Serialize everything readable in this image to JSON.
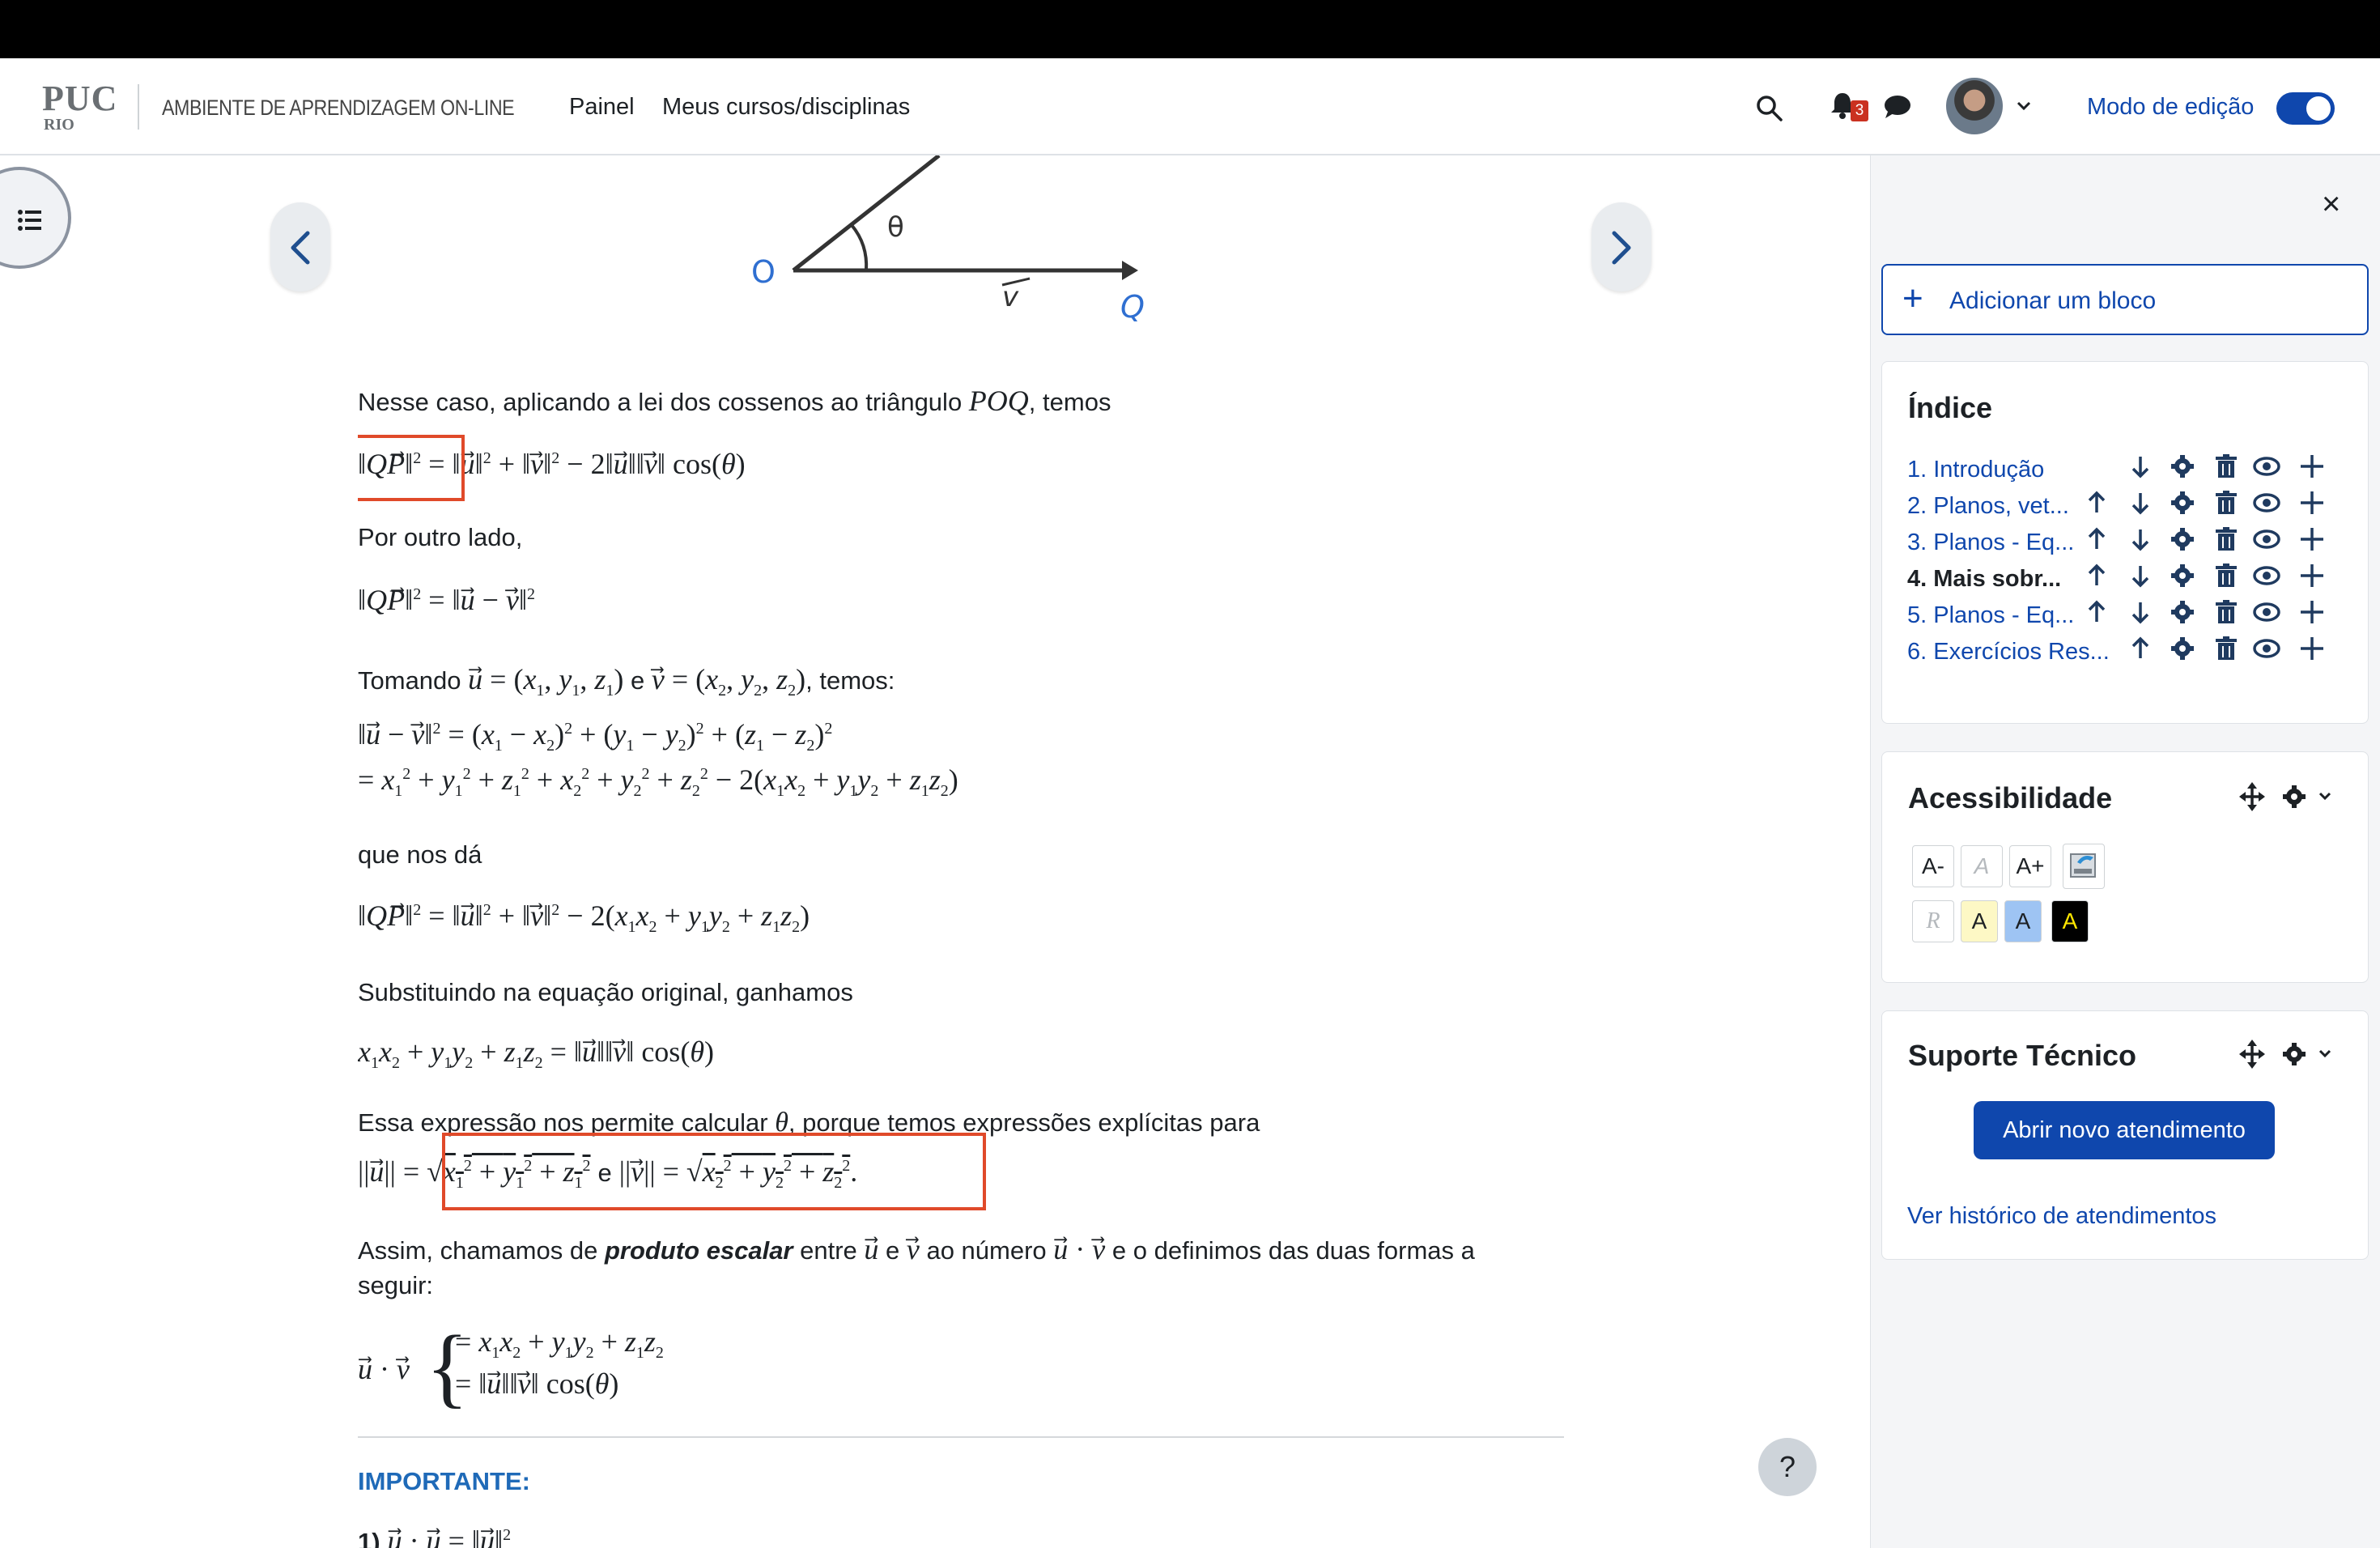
{
  "navbar": {
    "logo_top": "PUC",
    "logo_bottom": "RIO",
    "site_name": "AMBIENTE DE APRENDIZAGEM ON-LINE",
    "links": [
      "Painel",
      "Meus cursos/disciplinas"
    ],
    "notification_count": "3",
    "edit_mode_label": "Modo de edição",
    "edit_mode_on": true
  },
  "figure": {
    "label_o": "O",
    "label_theta": "θ",
    "label_v": "v",
    "label_q": "Q"
  },
  "content": {
    "p1_a": "Nesse caso, aplicando a lei dos cossenos ao triângulo ",
    "p1_math": "POQ",
    "p1_b": ", temos",
    "p2": "Por outro lado,",
    "p3_a": "Tomando ",
    "p3_b": " e ",
    "p3_c": ", temos:",
    "p4": "que nos dá",
    "p5": "Substituindo na equação original, ganhamos",
    "p6_a": "Essa expressão nos permite calcular ",
    "p6_b": ", porque temos expressões explícitas para",
    "p7_a": "Assim, chamamos de ",
    "p7_bold": "produto escalar",
    "p7_b": " entre ",
    "p7_c": " e ",
    "p7_d": " ao número ",
    "p7_e": " e o definimos das duas formas a",
    "p7_line2": "seguir:",
    "e_connector": "e",
    "important": "IMPORTANTE:",
    "last_line": "1)"
  },
  "drawer": {
    "add_block": "Adicionar um bloco",
    "toc_title": "Índice",
    "toc_items": [
      {
        "label": "1. Introdução",
        "current": false
      },
      {
        "label": "2. Planos, vet...",
        "current": false
      },
      {
        "label": "3. Planos - Eq...",
        "current": false
      },
      {
        "label": "4. Mais sobr...",
        "current": true
      },
      {
        "label": "5. Planos - Eq...",
        "current": false
      },
      {
        "label": "6. Exercícios Res...",
        "current": false
      }
    ],
    "access_title": "Acessibilidade",
    "access_row1": [
      "A-",
      "A",
      "A+"
    ],
    "access_row2": [
      "R",
      "A",
      "A",
      "A"
    ],
    "support_title": "Suporte Técnico",
    "support_button": "Abrir novo atendimento",
    "support_link": "Ver histórico de atendimentos"
  },
  "help_label": "?",
  "colors": {
    "brand": "#0f47ad",
    "highlight_box": "#e04a2a",
    "important": "#1f6ab8",
    "badge": "#ca3120"
  }
}
